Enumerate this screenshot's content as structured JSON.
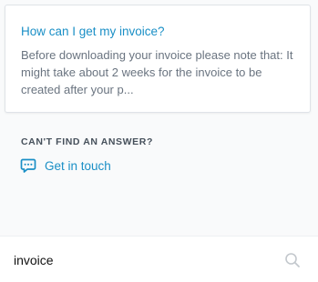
{
  "results": [
    {
      "title": "How can I get my invoice?",
      "snippet": "Before downloading your invoice please note that: It might take about 2 weeks for the invoice to be created after your p..."
    }
  ],
  "fallback": {
    "heading": "CAN'T FIND AN ANSWER?",
    "contact_label": "Get in touch",
    "contact_icon": "chat-bubble-icon"
  },
  "search": {
    "value": "invoice",
    "icon": "search-icon"
  },
  "colors": {
    "accent": "#1a8fc6",
    "background": "#f9fafb",
    "heading": "#46505b",
    "snippet": "#6a7480"
  }
}
